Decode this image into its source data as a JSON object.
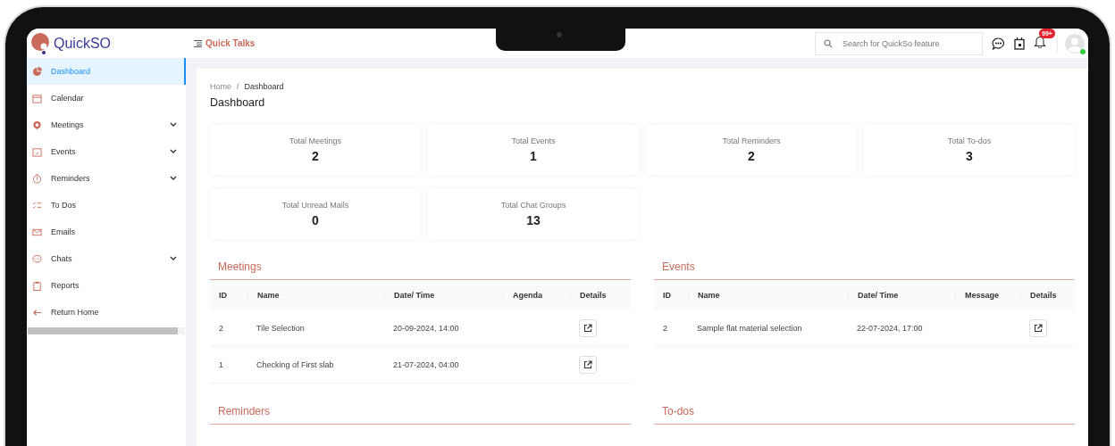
{
  "header": {
    "logo": "QuickSO",
    "quick_link": "Quick Talks",
    "search": {
      "placeholder": "Search for QuickSo feature"
    },
    "notification_badge": "99+",
    "avatar": {
      "online": true
    }
  },
  "sidebar": {
    "items": [
      {
        "label": "Dashboard",
        "expandable": false,
        "selected": true
      },
      {
        "label": "Calendar",
        "expandable": false,
        "selected": false
      },
      {
        "label": "Meetings",
        "expandable": true,
        "selected": false
      },
      {
        "label": "Events",
        "expandable": true,
        "selected": false
      },
      {
        "label": "Reminders",
        "expandable": true,
        "selected": false
      },
      {
        "label": "To Dos",
        "expandable": false,
        "selected": false
      },
      {
        "label": "Emails",
        "expandable": false,
        "selected": false
      },
      {
        "label": "Chats",
        "expandable": true,
        "selected": false
      },
      {
        "label": "Reports",
        "expandable": false,
        "selected": false
      },
      {
        "label": "Return Home",
        "expandable": false,
        "selected": false
      }
    ]
  },
  "breadcrumb": {
    "items": [
      "Home",
      "Dashboard"
    ],
    "separator": "/"
  },
  "page_title": "Dashboard",
  "stats": [
    {
      "label": "Total Meetings",
      "value": "2"
    },
    {
      "label": "Total Events",
      "value": "1"
    },
    {
      "label": "Total Reminders",
      "value": "2"
    },
    {
      "label": "Total To-dos",
      "value": "3"
    },
    {
      "label": "Total Unread Mails",
      "value": "0"
    },
    {
      "label": "Total Chat Groups",
      "value": "13"
    }
  ],
  "sections": [
    {
      "title": "Meetings",
      "columns": [
        "ID",
        "Name",
        "Date/ Time",
        "Agenda",
        "Details"
      ],
      "rows": [
        {
          "id": "2",
          "name": "Tile Selection",
          "date_time": "20-09-2024, 14:00"
        },
        {
          "id": "1",
          "name": "Checking of First slab",
          "date_time": "21-07-2024, 04:00"
        }
      ]
    },
    {
      "title": "Events",
      "columns": [
        "ID",
        "Name",
        "Date/ Time",
        "Message",
        "Details"
      ],
      "rows": [
        {
          "id": "2",
          "name": "Sample flat material selection",
          "date_time": "22-07-2024, 17:00"
        }
      ]
    },
    {
      "title": "Reminders"
    },
    {
      "title": "To-dos"
    }
  ]
}
